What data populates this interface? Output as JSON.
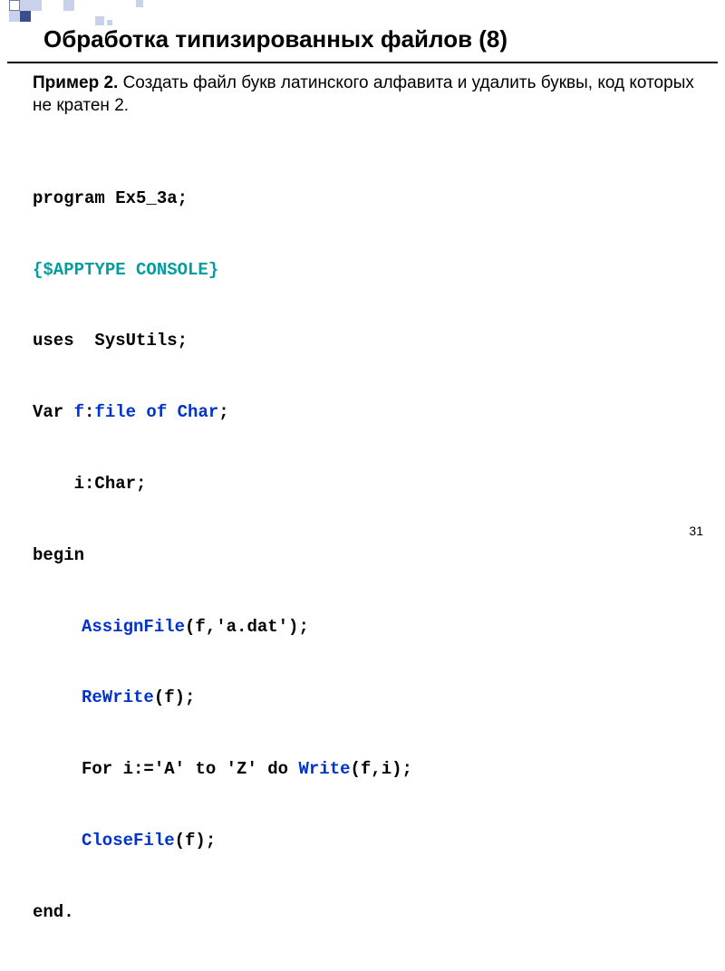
{
  "title": "Обработка типизированных файлов (8)",
  "example": {
    "label": "Пример 2.",
    "text": " Создать файл букв латинского алфавита и удалить буквы, код которых не кратен 2."
  },
  "code": {
    "l1a": "program",
    "l1b": " Ex5_3a;",
    "l2": "{$APPTYPE CONSOLE}",
    "l3a": "uses",
    "l3b": "  SysUtils;",
    "l4a": "Var ",
    "l4b": "f",
    "l4c": ":",
    "l4d": "file of Char",
    "l4e": ";",
    "l5a": "    i:",
    "l5b": "Char",
    "l5c": ";",
    "l6": "begin",
    "l7a": "AssignFile",
    "l7b": "(f,'a.dat');",
    "l8a": "ReWrite",
    "l8b": "(f);",
    "l9a": "For",
    "l9b": " i:='A' ",
    "l9c": "to",
    "l9d": " 'Z' ",
    "l9e": "do",
    "l9f": " ",
    "l9g": "Write",
    "l9h": "(f,i);",
    "l10a": "CloseFile",
    "l10b": "(f);",
    "l11": "end."
  },
  "page_number": "31"
}
